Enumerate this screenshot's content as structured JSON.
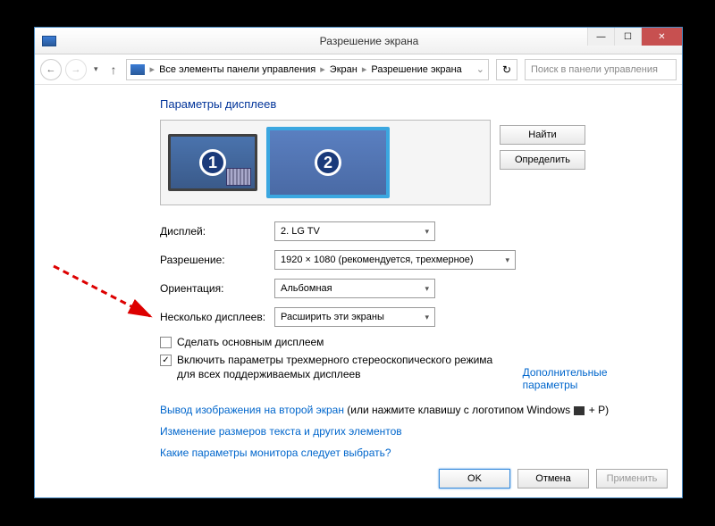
{
  "titlebar": {
    "title": "Разрешение экрана"
  },
  "window_buttons": {
    "min": "—",
    "max": "☐",
    "close": "✕"
  },
  "nav": {
    "back": "←",
    "forward": "→",
    "down": "▾",
    "up": "↑",
    "refresh": "↻"
  },
  "breadcrumb": {
    "root": "Все элементы панели управления",
    "seg1": "Экран",
    "seg2": "Разрешение экрана"
  },
  "search": {
    "placeholder": "Поиск в панели управления"
  },
  "heading": "Параметры дисплеев",
  "monitors": {
    "m1": "1",
    "m2": "2"
  },
  "side": {
    "find": "Найти",
    "identify": "Определить"
  },
  "form": {
    "display_label": "Дисплей:",
    "display_value": "2. LG TV",
    "resolution_label": "Разрешение:",
    "resolution_value": "1920 × 1080 (рекомендуется, трехмерное)",
    "orientation_label": "Ориентация:",
    "orientation_value": "Альбомная",
    "multi_label": "Несколько дисплеев:",
    "multi_value": "Расширить эти экраны"
  },
  "checkboxes": {
    "primary": "Сделать основным дисплеем",
    "stereo": "Включить параметры трехмерного стереоскопического режима для всех поддерживаемых дисплеев",
    "advanced_link": "Дополнительные параметры"
  },
  "links": {
    "project_prefix": "Вывод изображения на второй экран",
    "project_suffix": " (или нажмите клавишу с логотипом Windows ",
    "project_key": " + P)",
    "resize": "Изменение размеров текста и других элементов",
    "which": "Какие параметры монитора следует выбрать?"
  },
  "buttons": {
    "ok": "OK",
    "cancel": "Отмена",
    "apply": "Применить"
  }
}
